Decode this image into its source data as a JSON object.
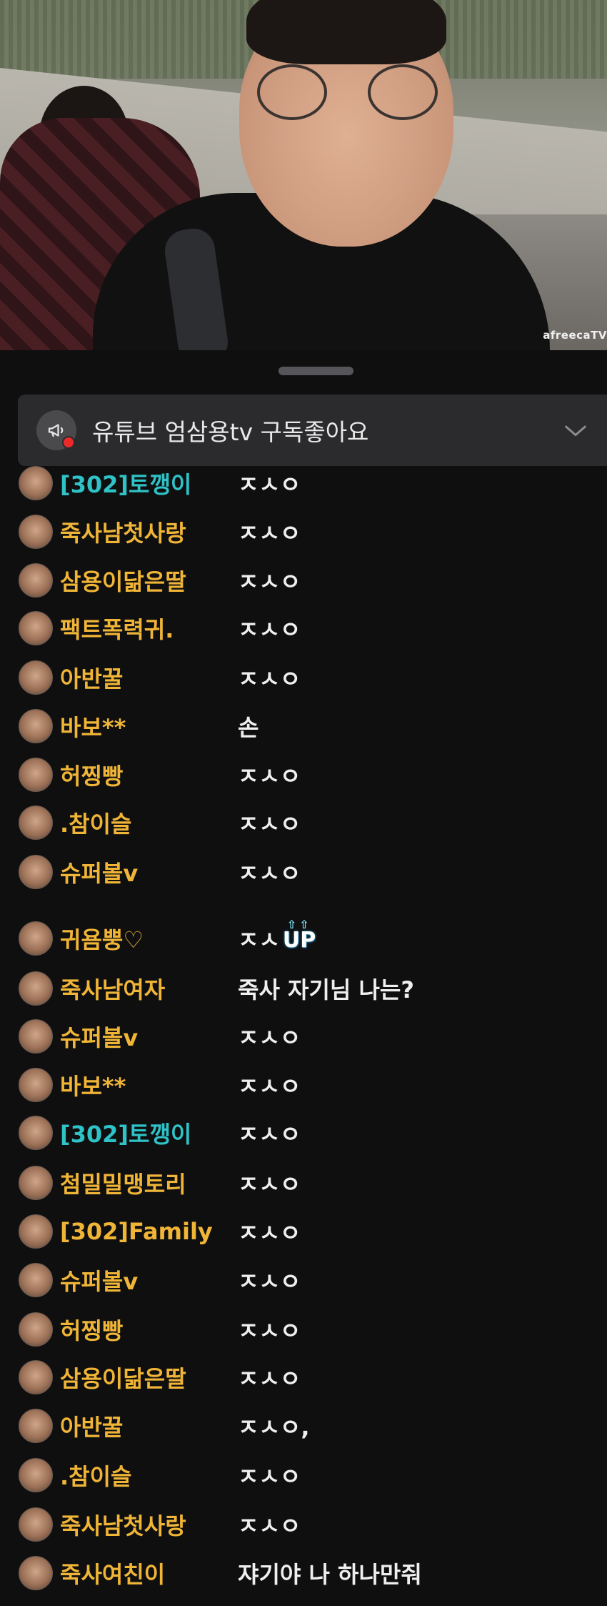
{
  "video": {
    "watermark": "afreecaTV"
  },
  "notice": {
    "text": "유튜브 엄삼용tv  구독좋아요",
    "icon": "megaphone-icon",
    "expand_icon": "chevron-down-icon"
  },
  "colors": {
    "nick_default": "#f0b537",
    "nick_fan": "#2fc2c7",
    "message": "#efefef",
    "background": "#0f0f10"
  },
  "chat": {
    "messages": [
      {
        "nick": "[302]토깽이",
        "text": "ㅈㅅㅇ",
        "fan": true
      },
      {
        "nick": "죽사남첫사랑",
        "text": "ㅈㅅㅇ",
        "fan": false
      },
      {
        "nick": "삼용이닮은딸",
        "text": "ㅈㅅㅇ",
        "fan": false
      },
      {
        "nick": "팩트폭력귀.",
        "text": "ㅈㅅㅇ",
        "fan": false
      },
      {
        "nick": "아반꿀",
        "text": "ㅈㅅㅇ",
        "fan": false
      },
      {
        "nick": "바보**",
        "text": "손",
        "fan": false
      },
      {
        "nick": "허찡빵",
        "text": "ㅈㅅㅇ",
        "fan": false
      },
      {
        "nick": ".참이슬",
        "text": "ㅈㅅㅇ",
        "fan": false
      },
      {
        "nick": "슈퍼볼v",
        "text": "ㅈㅅㅇ",
        "fan": false
      },
      {
        "nick": "귀욤뿡♡",
        "text": "ㅈㅅ",
        "fan": false,
        "badge": "UP"
      },
      {
        "nick": "죽사남여자",
        "text": "죽사 자기님 나는?",
        "fan": false
      },
      {
        "nick": "슈퍼볼v",
        "text": "ㅈㅅㅇ",
        "fan": false
      },
      {
        "nick": "바보**",
        "text": "ㅈㅅㅇ",
        "fan": false
      },
      {
        "nick": "[302]토깽이",
        "text": "ㅈㅅㅇ",
        "fan": true
      },
      {
        "nick": "첨밀밀맹토리",
        "text": "ㅈㅅㅇ",
        "fan": false
      },
      {
        "nick": "[302]Family",
        "text": "ㅈㅅㅇ",
        "fan": false
      },
      {
        "nick": "슈퍼볼v",
        "text": "ㅈㅅㅇ",
        "fan": false
      },
      {
        "nick": "허찡빵",
        "text": "ㅈㅅㅇ",
        "fan": false
      },
      {
        "nick": "삼용이닮은딸",
        "text": "ㅈㅅㅇ",
        "fan": false
      },
      {
        "nick": "아반꿀",
        "text": "ㅈㅅㅇ,",
        "fan": false
      },
      {
        "nick": ".참이슬",
        "text": "ㅈㅅㅇ",
        "fan": false
      },
      {
        "nick": "죽사남첫사랑",
        "text": "ㅈㅅㅇ",
        "fan": false
      },
      {
        "nick": "죽사여친이",
        "text": "쟈기야 나 하나만줘",
        "fan": false
      }
    ]
  }
}
